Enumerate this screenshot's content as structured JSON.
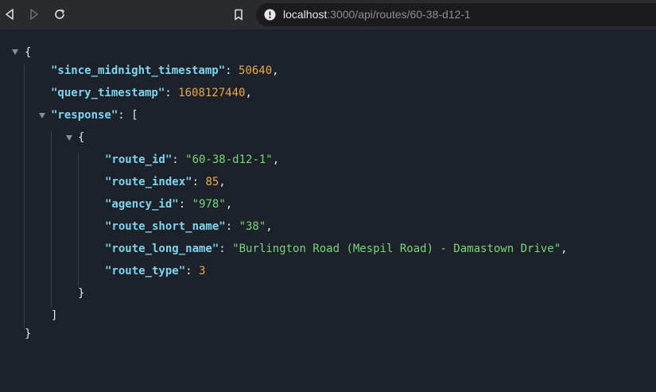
{
  "browser": {
    "url_host": "localhost",
    "url_rest": ":3000/api/routes/60-38-d12-1"
  },
  "json": {
    "open_brace": "{",
    "close_brace": "}",
    "since_midnight_timestamp": {
      "key": "\"since_midnight_timestamp\"",
      "value": "50640"
    },
    "query_timestamp": {
      "key": "\"query_timestamp\"",
      "value": "1608127440"
    },
    "response": {
      "key": "\"response\"",
      "open": "[",
      "close": "]"
    },
    "item": {
      "open": "{",
      "close": "}",
      "route_id": {
        "key": "\"route_id\"",
        "value": "\"60-38-d12-1\""
      },
      "route_index": {
        "key": "\"route_index\"",
        "value": "85"
      },
      "agency_id": {
        "key": "\"agency_id\"",
        "value": "\"978\""
      },
      "route_short_name": {
        "key": "\"route_short_name\"",
        "value": "\"38\""
      },
      "route_long_name": {
        "key": "\"route_long_name\"",
        "value": "\"Burlington Road (Mespil Road) - Damastown Drive\""
      },
      "route_type": {
        "key": "\"route_type\"",
        "value": "3"
      }
    }
  },
  "colors": {
    "background": "#1c212a",
    "key": "#7fd5ee",
    "string": "#76d776",
    "number": "#e8a94b"
  }
}
